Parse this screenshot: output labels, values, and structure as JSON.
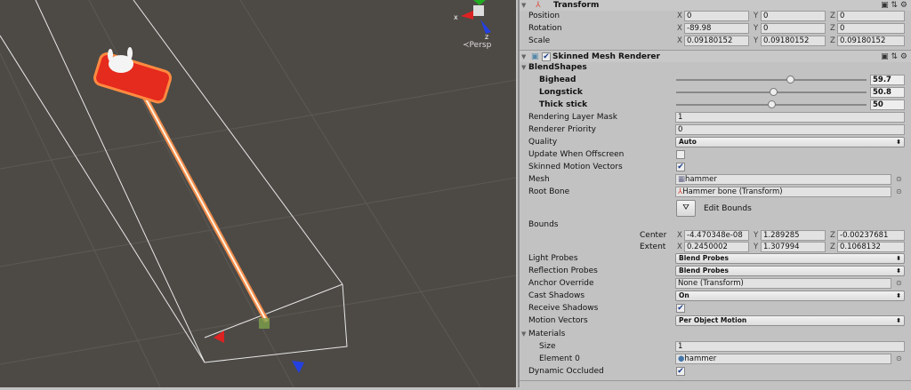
{
  "scene": {
    "view_label": "Persp",
    "gizmo_x": "x",
    "gizmo_z": "z"
  },
  "transform": {
    "title": "Transform",
    "position": {
      "label": "Position",
      "x": "0",
      "y": "0",
      "z": "0"
    },
    "rotation": {
      "label": "Rotation",
      "x": "-89.98",
      "y": "0",
      "z": "0"
    },
    "scale": {
      "label": "Scale",
      "x": "0.09180152",
      "y": "0.09180152",
      "z": "0.09180152"
    }
  },
  "smr": {
    "title": "Skinned Mesh Renderer",
    "enabled": true,
    "blendshapes_label": "BlendShapes",
    "blendshapes": [
      {
        "name": "Bighead",
        "value": "59.7",
        "pct": 59.7
      },
      {
        "name": "Longstick",
        "value": "50.8",
        "pct": 50.8
      },
      {
        "name": "Thick stick",
        "value": "50",
        "pct": 50
      }
    ],
    "rendering_layer_mask": {
      "label": "Rendering Layer Mask",
      "value": "1"
    },
    "renderer_priority": {
      "label": "Renderer Priority",
      "value": "0"
    },
    "quality": {
      "label": "Quality",
      "value": "Auto"
    },
    "update_offscreen": {
      "label": "Update When Offscreen",
      "checked": false
    },
    "skinned_motion": {
      "label": "Skinned Motion Vectors",
      "checked": true
    },
    "mesh": {
      "label": "Mesh",
      "value": "hammer"
    },
    "root_bone": {
      "label": "Root Bone",
      "value": "Hammer bone (Transform)"
    },
    "edit_bounds": "Edit Bounds",
    "bounds": {
      "label": "Bounds",
      "center_label": "Center",
      "extent_label": "Extent",
      "center": {
        "x": "-4.470348e-08",
        "y": "1.289285",
        "z": "-0.00237681"
      },
      "extent": {
        "x": "0.2450002",
        "y": "1.307994",
        "z": "0.1068132"
      }
    },
    "light_probes": {
      "label": "Light Probes",
      "value": "Blend Probes"
    },
    "reflection_probes": {
      "label": "Reflection Probes",
      "value": "Blend Probes"
    },
    "anchor_override": {
      "label": "Anchor Override",
      "value": "None (Transform)"
    },
    "cast_shadows": {
      "label": "Cast Shadows",
      "value": "On"
    },
    "receive_shadows": {
      "label": "Receive Shadows",
      "checked": true
    },
    "motion_vectors": {
      "label": "Motion Vectors",
      "value": "Per Object Motion"
    },
    "materials": {
      "label": "Materials",
      "size_label": "Size",
      "size": "1",
      "element_label": "Element 0",
      "element": "hammer"
    },
    "dynamic_occluded": {
      "label": "Dynamic Occluded",
      "checked": true
    }
  },
  "axis": {
    "x": "X",
    "y": "Y",
    "z": "Z"
  },
  "check": "✔"
}
